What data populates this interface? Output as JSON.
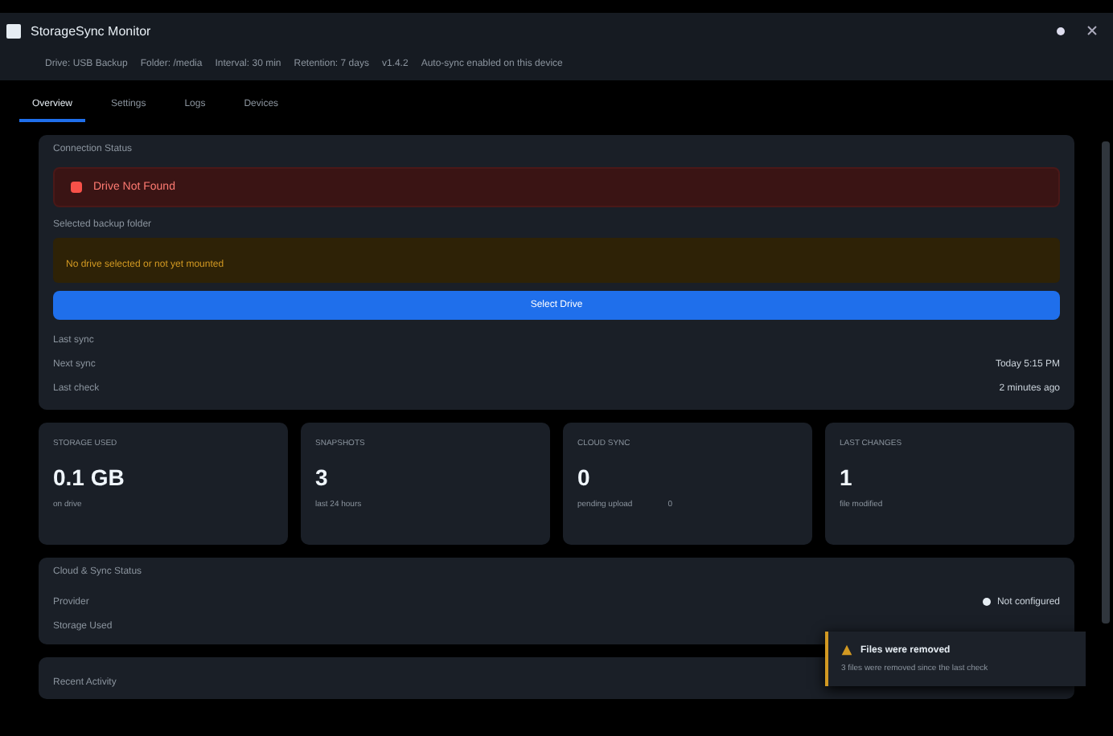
{
  "window": {
    "title": "StorageSync Monitor"
  },
  "info_bar": [
    "Drive: USB Backup",
    "Folder: /media",
    "Interval: 30 min",
    "Retention: 7 days",
    "v1.4.2",
    "Auto-sync enabled on this device"
  ],
  "tabs": [
    {
      "label": "Overview",
      "selected": true
    },
    {
      "label": "Settings",
      "selected": false
    },
    {
      "label": "Logs",
      "selected": false
    },
    {
      "label": "Devices",
      "selected": false
    }
  ],
  "status": {
    "heading": "Connection Status",
    "alert": "Drive Not Found",
    "folder_label": "Selected backup folder",
    "warning": "No drive selected or not yet mounted",
    "button": "Select Drive",
    "rows": [
      {
        "label": "Last sync",
        "value": ""
      },
      {
        "label": "Next sync",
        "value": "Today 5:15 PM"
      },
      {
        "label": "Last check",
        "value": "2 minutes ago"
      }
    ]
  },
  "stats": [
    {
      "label": "STORAGE USED",
      "value": "0.1 GB",
      "note": "on drive"
    },
    {
      "label": "SNAPSHOTS",
      "value": "3",
      "note": "last 24 hours"
    },
    {
      "label": "CLOUD SYNC",
      "value": "0",
      "note": "pending upload",
      "extra": "0"
    },
    {
      "label": "LAST CHANGES",
      "value": "1",
      "note": "file modified"
    }
  ],
  "cloud": {
    "heading": "Cloud & Sync Status",
    "rows": [
      "Provider",
      "Storage Used"
    ],
    "status": "Not configured"
  },
  "activity": {
    "heading": "Recent Activity"
  },
  "toast": {
    "title": "Files were removed",
    "message": "3 files were removed since the last check"
  }
}
